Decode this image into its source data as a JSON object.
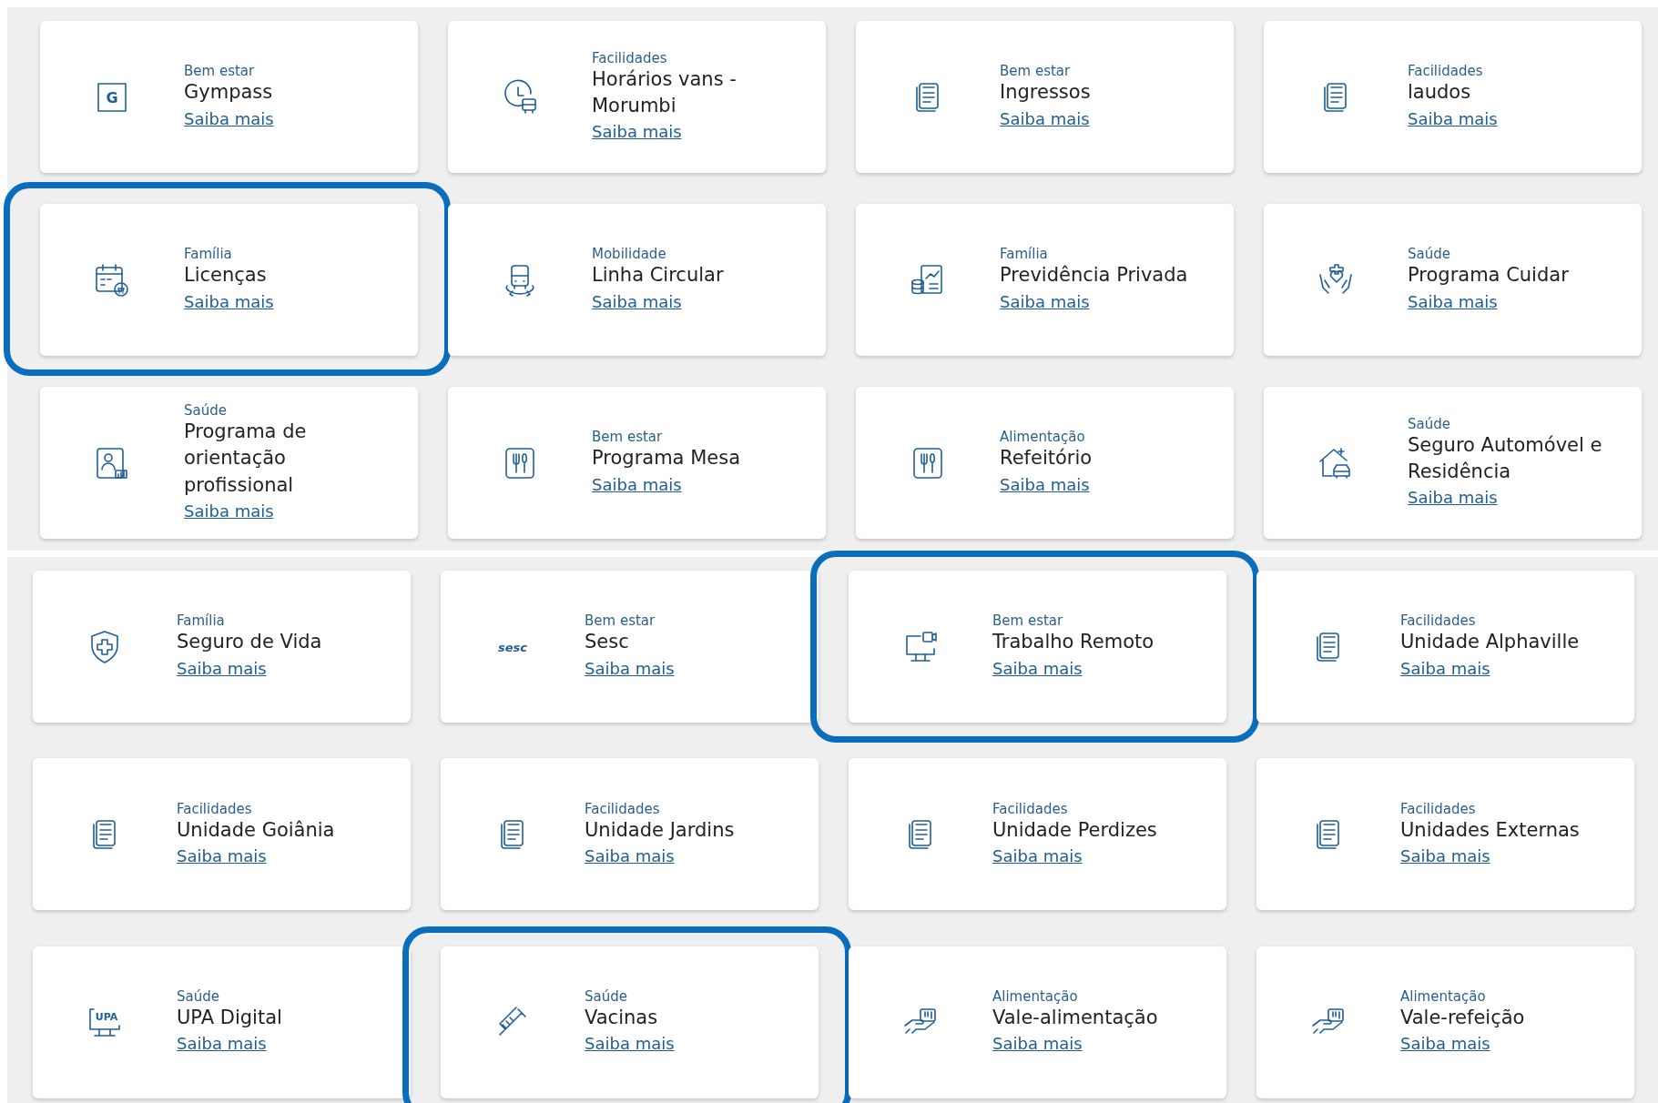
{
  "panels": [
    {
      "cards": [
        {
          "kind": "logo-letter",
          "logo_text": "G",
          "category": "Bem estar",
          "title": "Gympass",
          "link": "Saiba mais",
          "highlighted": false
        },
        {
          "kind": "clock-van",
          "category": "Facilidades",
          "title": "Horários vans  - Morumbi",
          "link": "Saiba mais",
          "highlighted": false
        },
        {
          "kind": "document",
          "category": "Bem estar",
          "title": "Ingressos",
          "link": "Saiba mais",
          "highlighted": false
        },
        {
          "kind": "document",
          "category": "Facilidades",
          "title": "laudos",
          "link": "Saiba mais",
          "highlighted": false
        },
        {
          "kind": "calendar",
          "category": "Família",
          "title": "Licenças",
          "link": "Saiba mais",
          "highlighted": true
        },
        {
          "kind": "bus",
          "category": "Mobilidade",
          "title": "Linha Circular",
          "link": "Saiba mais",
          "highlighted": false
        },
        {
          "kind": "coins-chart",
          "category": "Família",
          "title": "Previdência Privada",
          "link": "Saiba mais",
          "highlighted": false
        },
        {
          "kind": "care",
          "category": "Saúde",
          "title": "Programa Cuidar",
          "link": "Saiba mais",
          "highlighted": false
        },
        {
          "kind": "person-chart",
          "category": "Saúde",
          "title": "Programa de orientação profissional",
          "link": "Saiba mais",
          "highlighted": false
        },
        {
          "kind": "cutlery",
          "category": "Bem estar",
          "title": "Programa Mesa",
          "link": "Saiba mais",
          "highlighted": false
        },
        {
          "kind": "cutlery",
          "category": "Alimentação",
          "title": "Refeitório",
          "link": "Saiba mais",
          "highlighted": false
        },
        {
          "kind": "house",
          "category": "Saúde",
          "title": "Seguro Automóvel e Residência",
          "link": "Saiba mais",
          "highlighted": false
        }
      ]
    },
    {
      "cards": [
        {
          "kind": "shield",
          "category": "Família",
          "title": "Seguro de Vida",
          "link": "Saiba mais",
          "highlighted": false
        },
        {
          "kind": "logo-word",
          "logo_text": "sesc",
          "category": "Bem estar",
          "title": "Sesc",
          "link": "Saiba mais",
          "highlighted": false
        },
        {
          "kind": "monitor",
          "category": "Bem estar",
          "title": "Trabalho Remoto",
          "link": "Saiba mais",
          "highlighted": true
        },
        {
          "kind": "document",
          "category": "Facilidades",
          "title": "Unidade Alphaville",
          "link": "Saiba mais",
          "highlighted": false
        },
        {
          "kind": "document",
          "category": "Facilidades",
          "title": "Unidade Goiânia",
          "link": "Saiba mais",
          "highlighted": false
        },
        {
          "kind": "document",
          "category": "Facilidades",
          "title": "Unidade Jardins",
          "link": "Saiba mais",
          "highlighted": false
        },
        {
          "kind": "document",
          "category": "Facilidades",
          "title": "Unidade Perdizes",
          "link": "Saiba mais",
          "highlighted": false
        },
        {
          "kind": "document",
          "category": "Facilidades",
          "title": "Unidades Externas",
          "link": "Saiba mais",
          "highlighted": false
        },
        {
          "kind": "upa",
          "logo_text": "UPA",
          "category": "Saúde",
          "title": "UPA Digital",
          "link": "Saiba mais",
          "highlighted": false
        },
        {
          "kind": "syringe",
          "category": "Saúde",
          "title": "Vacinas",
          "link": "Saiba mais",
          "highlighted": true
        },
        {
          "kind": "hand-cutlery",
          "category": "Alimentação",
          "title": "Vale-alimentação",
          "link": "Saiba mais",
          "highlighted": false
        },
        {
          "kind": "hand-cutlery",
          "category": "Alimentação",
          "title": "Vale-refeição",
          "link": "Saiba mais",
          "highlighted": false
        }
      ]
    }
  ]
}
